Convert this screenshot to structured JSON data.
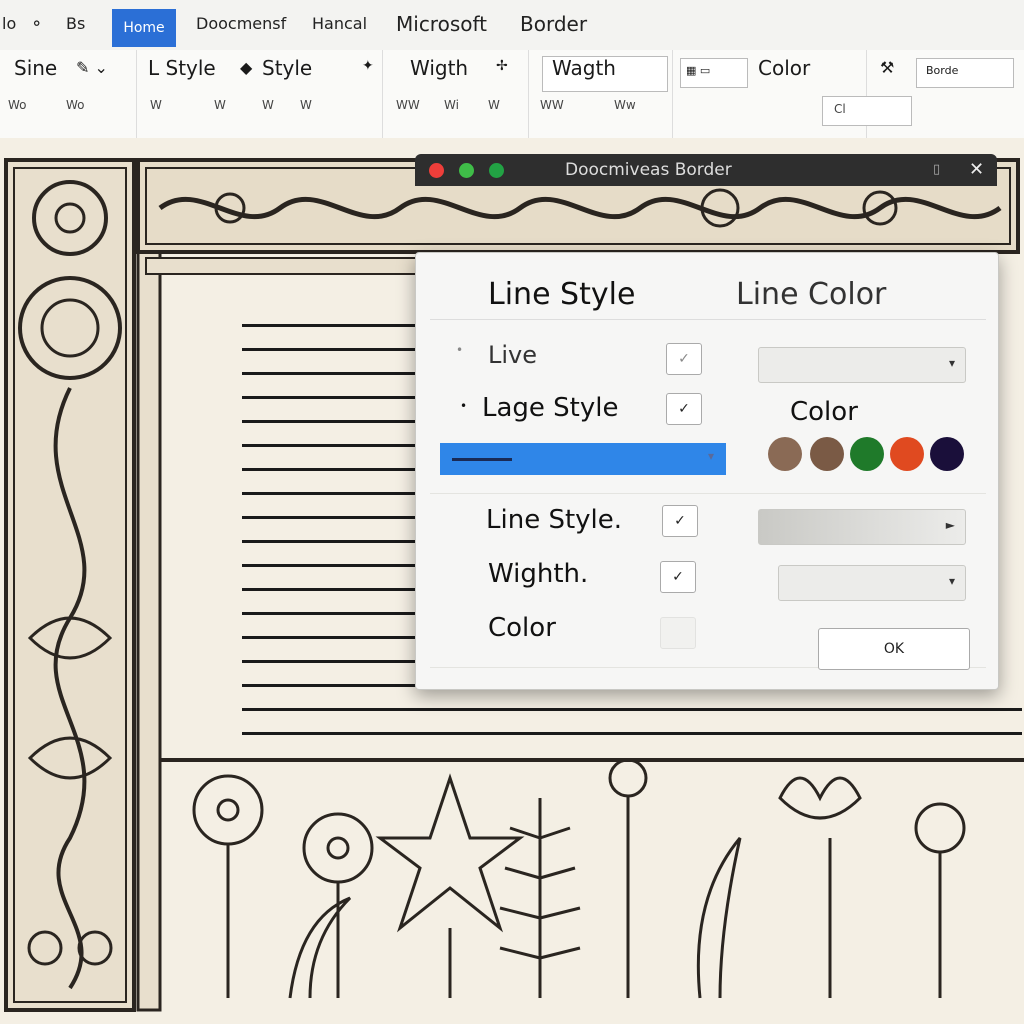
{
  "titlebar": {
    "items": [
      "lo",
      "⚬",
      "Bs",
      "Home",
      "Doocmensf",
      "Hancal",
      "Microsoft",
      "Border"
    ]
  },
  "ribbon": {
    "row1": [
      "Sine",
      "L Style",
      "Style",
      "Wigth",
      "Wagth",
      "Color"
    ],
    "row1_icons": [
      "paint-icon",
      "font-icon",
      "format-icon",
      "brush-icon",
      "table-icon",
      "tool-icon"
    ],
    "row2": [
      "Wo",
      "Wo",
      "W",
      "W",
      "W",
      "W",
      "WW",
      "Wi",
      "W",
      "WW",
      "Ww",
      "Cl"
    ],
    "right_box": "Color",
    "small_box": "Borde"
  },
  "dialog": {
    "title": "Doocmiveas Border",
    "close": "✕",
    "header_left": "Line Style",
    "header_right": "Line Color",
    "row1_label": "Live",
    "row2_label": "Lage Style",
    "color_label": "Color",
    "row3_label": "Line Style.",
    "row4_label": "Wighth.",
    "row5_label": "Color",
    "ok_button": "OK",
    "check_mark": "✓",
    "dropdown_arrow": "▾",
    "colors": [
      "#8a6a55",
      "#7a5a45",
      "#1f7a2a",
      "#e04a20",
      "#1a0f3a"
    ],
    "traffic": [
      "#ee3e3a",
      "#3fbd48",
      "#22a244"
    ]
  }
}
